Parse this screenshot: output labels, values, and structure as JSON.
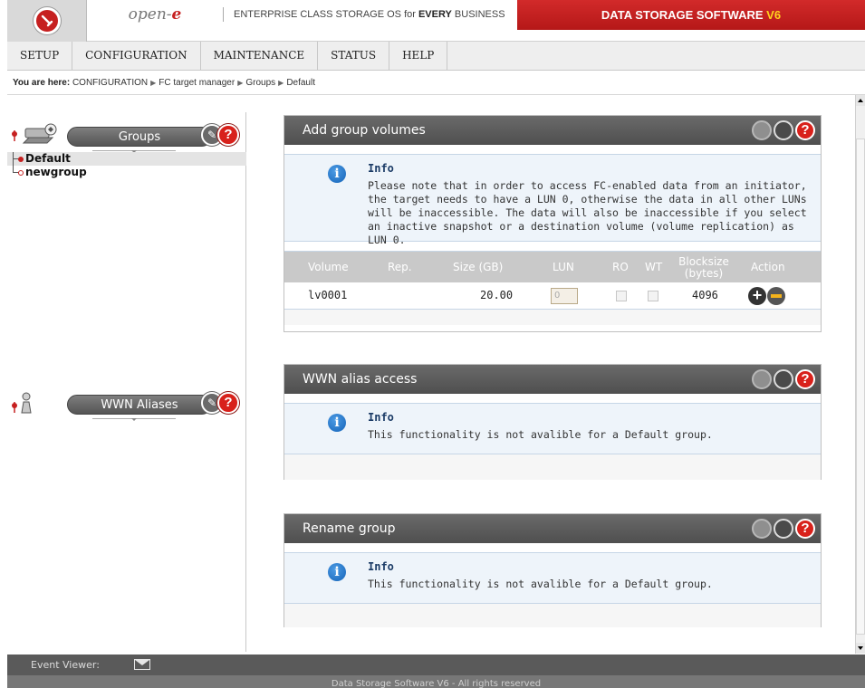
{
  "header": {
    "brand_prefix": "open-",
    "brand_e": "e",
    "tagline_pre": "ENTERPRISE CLASS STORAGE OS for ",
    "tagline_bold": "EVERY",
    "tagline_post": " BUSINESS",
    "product": "DATA STORAGE SOFTWARE ",
    "product_version": "V6"
  },
  "menu": {
    "items": [
      {
        "label": "SETUP"
      },
      {
        "label": "CONFIGURATION"
      },
      {
        "label": "MAINTENANCE"
      },
      {
        "label": "STATUS"
      },
      {
        "label": "HELP"
      }
    ]
  },
  "breadcrumb": {
    "prefix": "You are here:",
    "items": [
      "CONFIGURATION",
      "FC target manager",
      "Groups",
      "Default"
    ]
  },
  "groups_panel": {
    "title": "Groups",
    "tree": [
      {
        "label": "Default",
        "selected": true
      },
      {
        "label": "newgroup",
        "selected": false
      }
    ]
  },
  "wwn_panel": {
    "title": "WWN Aliases"
  },
  "sections": {
    "add_volumes": {
      "title": "Add group volumes",
      "info_title": "Info",
      "info_text": "Please note that in order to access FC-enabled data from an initiator, the target needs to have a LUN 0, otherwise the data in all other LUNs will be inaccessible. The data will also be inaccessible if you select an inactive snapshot or a destination volume (volume replication) as LUN 0.",
      "columns": {
        "volume": "Volume",
        "rep": "Rep.",
        "size": "Size (GB)",
        "lun": "LUN",
        "ro": "RO",
        "wt": "WT",
        "blocksize_1": "Blocksize",
        "blocksize_2": "(bytes)",
        "action": "Action"
      },
      "rows": [
        {
          "volume": "lv0001",
          "rep": "",
          "size": "20.00",
          "lun": "0",
          "ro": false,
          "wt": false,
          "blocksize": "4096"
        }
      ]
    },
    "wwn_access": {
      "title": "WWN alias access",
      "info_title": "Info",
      "info_text": "This functionality is not avalible for a Default group."
    },
    "rename": {
      "title": "Rename group",
      "info_title": "Info",
      "info_text": "This functionality is not avalible for a Default group."
    }
  },
  "event_viewer": {
    "label": "Event Viewer:"
  },
  "footer": {
    "text": "Data Storage Software V6 - All rights reserved"
  },
  "colors": {
    "brand_red": "#c62020",
    "section_header": "#555555",
    "info_bg": "#eef4fa",
    "table_header": "#c9c9c9"
  }
}
